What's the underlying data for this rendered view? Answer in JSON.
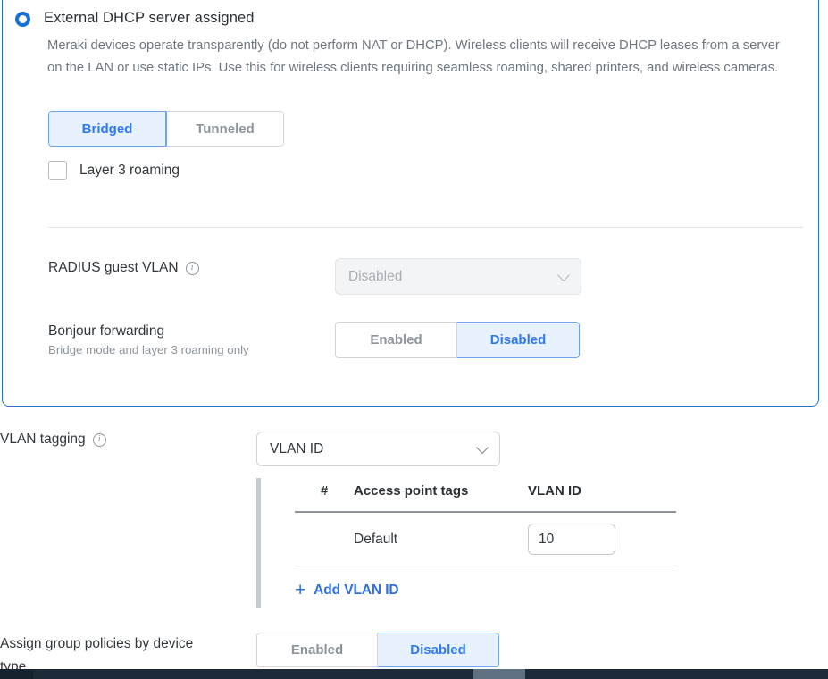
{
  "card": {
    "radio_label": "External DHCP server assigned",
    "radio_selected": true,
    "description": "Meraki devices operate transparently (do not perform NAT or DHCP). Wireless clients will receive DHCP leases from a server on the LAN or use static IPs. Use this for wireless clients requiring seamless roaming, shared printers, and wireless cameras.",
    "mode_toggle": {
      "options": [
        "Bridged",
        "Tunneled"
      ],
      "selected": "Bridged"
    },
    "layer3_roaming": {
      "label": "Layer 3 roaming",
      "checked": false
    },
    "radius_guest_vlan": {
      "label": "RADIUS guest VLAN",
      "info_icon": "info-icon",
      "value": "Disabled",
      "disabled": true
    },
    "bonjour_forwarding": {
      "label": "Bonjour forwarding",
      "sublabel": "Bridge mode and layer 3 roaming only",
      "options": [
        "Enabled",
        "Disabled"
      ],
      "selected": "Disabled"
    }
  },
  "vlan_tagging": {
    "label": "VLAN tagging",
    "info_icon": "info-icon",
    "value": "VLAN ID",
    "table": {
      "headers": [
        "#",
        "Access point tags",
        "VLAN ID"
      ],
      "rows": [
        {
          "num": "",
          "tags": "Default",
          "vlan_id": "10"
        }
      ]
    },
    "add_link": "Add VLAN ID",
    "add_icon": "plus-icon"
  },
  "assign_group_policies": {
    "label": "Assign group policies by device type",
    "options": [
      "Enabled",
      "Disabled"
    ],
    "selected": "Disabled"
  },
  "colors": {
    "accent_blue": "#1f75cb",
    "link_blue": "#2f6fe0",
    "active_seg_bg": "#e8f1fe",
    "active_seg_text": "#2f7bec",
    "muted_text": "#8d949b",
    "scrollbar_track": "#1d2b39",
    "scrollbar_thumb": "#5f7183"
  }
}
